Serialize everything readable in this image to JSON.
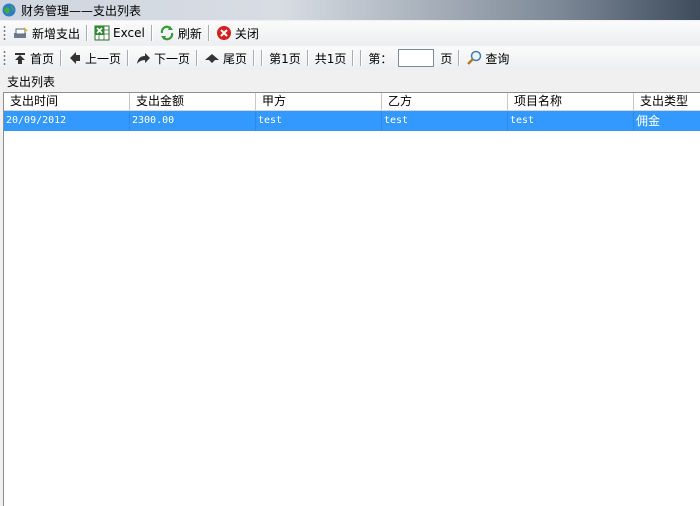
{
  "window": {
    "title": "财务管理——支出列表"
  },
  "toolbar_main": {
    "new_label": "新增支出",
    "excel_label": "Excel",
    "refresh_label": "刷新",
    "close_label": "关闭"
  },
  "toolbar_paging": {
    "first_label": "首页",
    "prev_label": "上一页",
    "next_label": "下一页",
    "last_label": "尾页",
    "current_page": "第1页",
    "total_pages": "共1页",
    "goto_prefix": "第：",
    "goto_value": "",
    "goto_suffix": "页",
    "query_label": "查询"
  },
  "list": {
    "label": "支出列表",
    "columns": [
      "支出时间",
      "支出金额",
      "甲方",
      "乙方",
      "项目名称",
      "支出类型"
    ],
    "rows": [
      [
        "20/09/2012",
        "2300.00",
        "test",
        "test",
        "test",
        "佣金"
      ]
    ],
    "selected_row": 0
  },
  "colors": {
    "selection": "#3399ff",
    "background": "#f0f0f0"
  }
}
